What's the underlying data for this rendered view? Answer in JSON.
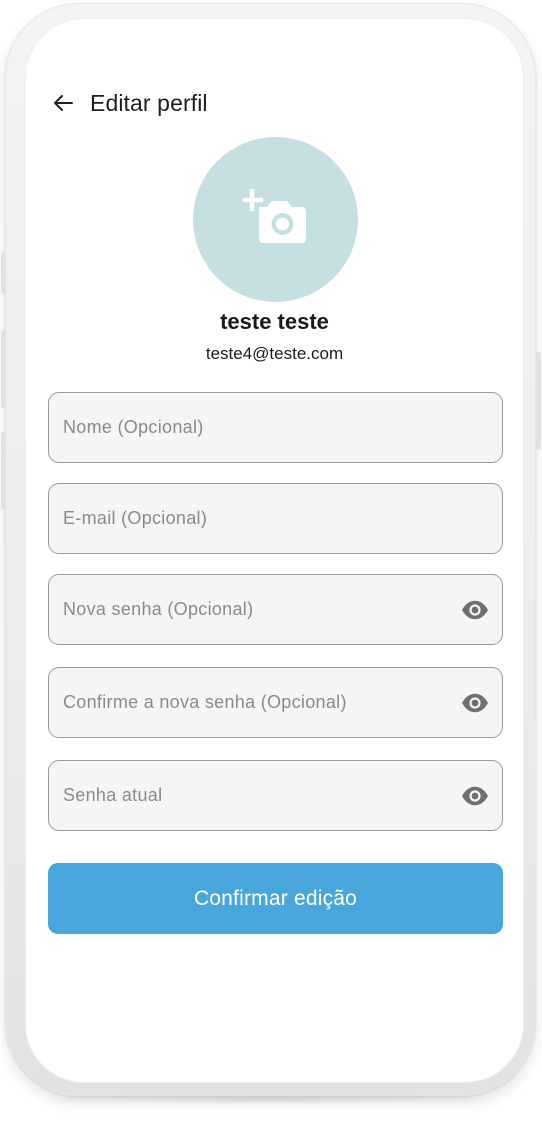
{
  "header": {
    "title": "Editar perfil"
  },
  "profile": {
    "name": "teste teste",
    "email": "teste4@teste.com",
    "avatar_icon": "add-photo-icon",
    "avatar_color": "#c6dfe3"
  },
  "form": {
    "name_placeholder": "Nome (Opcional)",
    "email_placeholder": "E-mail (Opcional)",
    "new_password_placeholder": "Nova senha (Opcional)",
    "confirm_password_placeholder": "Confirme a nova senha (Opcional)",
    "current_password_placeholder": "Senha atual",
    "eye_icon": "visibility-icon"
  },
  "actions": {
    "confirm_label": "Confirmar edição",
    "confirm_color": "#48a6db"
  }
}
